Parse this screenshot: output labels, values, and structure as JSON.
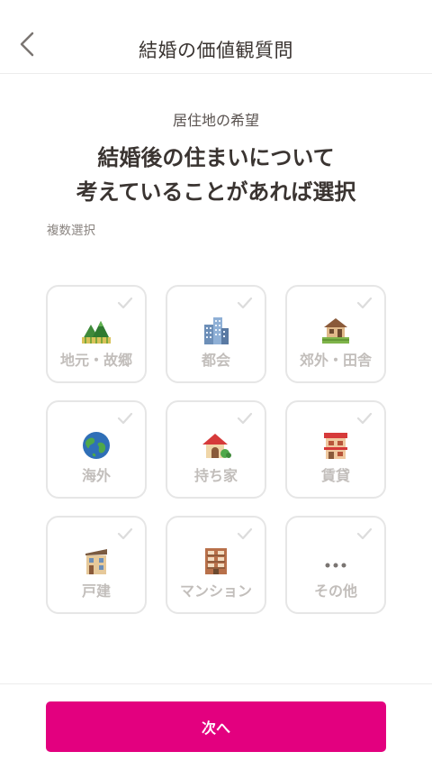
{
  "header": {
    "title": "結婚の価値観質問",
    "back_icon": "chevron-left-icon"
  },
  "question": {
    "category": "居住地の希望",
    "line1": "結婚後の住まいについて",
    "line2": "考えていることがあれば選択",
    "hint": "複数選択"
  },
  "options": [
    {
      "label": "地元・故郷",
      "icon": "mountains-icon",
      "selected": false
    },
    {
      "label": "都会",
      "icon": "city-buildings-icon",
      "selected": false
    },
    {
      "label": "郊外・田舎",
      "icon": "country-house-icon",
      "selected": false
    },
    {
      "label": "海外",
      "icon": "globe-icon",
      "selected": false
    },
    {
      "label": "持ち家",
      "icon": "house-garden-icon",
      "selected": false
    },
    {
      "label": "賃貸",
      "icon": "apartment-shop-icon",
      "selected": false
    },
    {
      "label": "戸建",
      "icon": "detached-house-icon",
      "selected": false
    },
    {
      "label": "マンション",
      "icon": "condominium-icon",
      "selected": false
    },
    {
      "label": "その他",
      "icon": "ellipsis-icon",
      "selected": false
    }
  ],
  "footer": {
    "next_label": "次へ"
  },
  "colors": {
    "accent": "#e3007f",
    "label_inactive": "#c2bebb",
    "card_border": "#e6e6e6",
    "text_primary": "#3a3431"
  }
}
